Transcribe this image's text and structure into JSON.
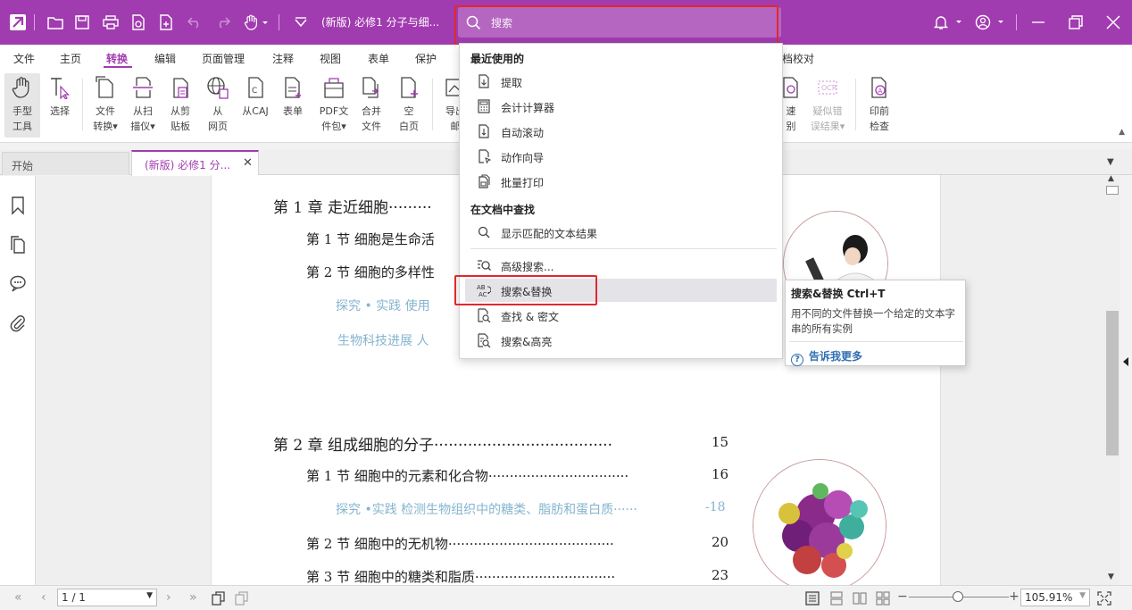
{
  "titlebar": {
    "doc_title": "(新版) 必修1 分子与细...",
    "search_placeholder": "搜索"
  },
  "menu": {
    "tabs": [
      "文件",
      "主页",
      "转换",
      "编辑",
      "页面管理",
      "注释",
      "视图",
      "表单",
      "保护",
      "档校对"
    ],
    "active": "转换"
  },
  "ribbon": {
    "buttons": [
      {
        "label": "手型\n工具",
        "icon": "hand-icon"
      },
      {
        "label": "选择",
        "icon": "select-text-icon"
      },
      {
        "label": "文件\n转换▾",
        "icon": "file-convert-icon"
      },
      {
        "label": "从扫\n描仪▾",
        "icon": "scanner-icon"
      },
      {
        "label": "从剪\n贴板",
        "icon": "clipboard-icon"
      },
      {
        "label": "从\n网页",
        "icon": "web-icon"
      },
      {
        "label": "从CAJ",
        "icon": "caj-icon"
      },
      {
        "label": "表单",
        "icon": "form-icon"
      },
      {
        "label": "PDF文\n件包▾",
        "icon": "pdf-package-icon"
      },
      {
        "label": "合并\n文件",
        "icon": "merge-icon"
      },
      {
        "label": "空\n白页",
        "icon": "blank-page-icon"
      },
      {
        "label": "导出\n邮",
        "icon": "export-icon"
      },
      {
        "label": "速\n别",
        "icon": "ocr-icon"
      },
      {
        "label": "疑似错\n误结果▾",
        "icon": "suspect-ocr-icon"
      },
      {
        "label": "印前\n检查",
        "icon": "preflight-icon"
      }
    ]
  },
  "tabs": {
    "start": "开始",
    "doc": "(新版)  必修1 分...",
    "close": "✕"
  },
  "document": {
    "toc": [
      {
        "text": "第 1 章    走近细胞·········",
        "page": ""
      },
      {
        "text": "第 1 节    细胞是生命活",
        "page": ""
      },
      {
        "text": "第 2 节    细胞的多样性",
        "page": ""
      },
      {
        "text": "探究 • 实践    使用",
        "page": ""
      },
      {
        "text": "生物科技进展    人",
        "page": ""
      },
      {
        "text": "第 2 章    组成细胞的分子·····································",
        "page": "15"
      },
      {
        "text": "第 1 节    细胞中的元素和化合物·································",
        "page": "16"
      },
      {
        "text": "探究 •实践    检测生物组织中的糖类、脂肪和蛋白质······",
        "page": "-18"
      },
      {
        "text": "第 2 节    细胞中的无机物·······································",
        "page": "20"
      },
      {
        "text": "第 3 节    细胞中的糖类和脂质·································",
        "page": "23"
      }
    ]
  },
  "dropdown": {
    "section_recent": "最近使用的",
    "recent": [
      {
        "label": "提取",
        "icon": "extract-icon"
      },
      {
        "label": "会计计算器",
        "icon": "calculator-icon"
      },
      {
        "label": "自动滚动",
        "icon": "auto-scroll-icon"
      },
      {
        "label": "动作向导",
        "icon": "action-wizard-icon"
      },
      {
        "label": "批量打印",
        "icon": "batch-print-icon"
      }
    ],
    "section_find": "在文档中查找",
    "find": [
      {
        "label": "显示匹配的文本结果",
        "icon": "search-icon"
      },
      {
        "label": "高级搜索...",
        "icon": "advanced-search-icon"
      },
      {
        "label": "搜索&替换",
        "icon": "search-replace-icon"
      },
      {
        "label": "查找 & 密文",
        "icon": "find-redact-icon"
      },
      {
        "label": "搜索&高亮",
        "icon": "search-highlight-icon"
      }
    ]
  },
  "tooltip": {
    "title": "搜索&替换    Ctrl+T",
    "description": "用不同的文件替换一个给定的文本字串的所有实例",
    "link": "告诉我更多"
  },
  "statusbar": {
    "page_value": "1 / 1",
    "zoom_value": "105.91%",
    "zoom_minus": "−",
    "zoom_plus": "+"
  },
  "colors": {
    "brand": "#a13bb0",
    "highlight_frame": "#e0292b",
    "link": "#2f6fb3"
  }
}
